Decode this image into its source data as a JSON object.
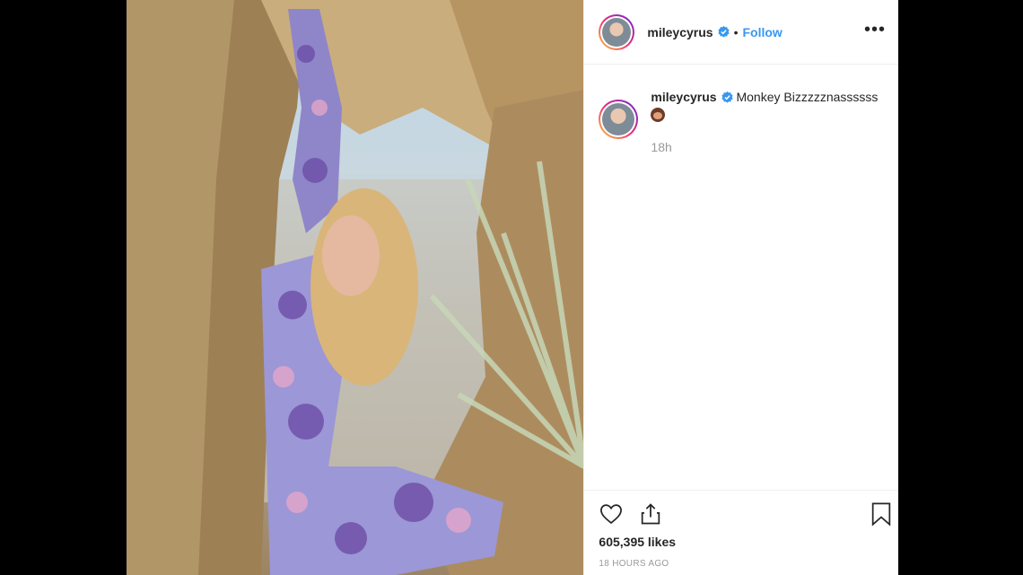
{
  "post": {
    "username": "mileycyrus",
    "follow_label": "Follow",
    "separator": "•",
    "more_label": "•••",
    "caption_user": "mileycyrus",
    "caption_text": "Monkey Bizzzzznassssss",
    "comment_time": "18h",
    "likes": "605,395 likes",
    "posted_ago": "18 HOURS AGO"
  },
  "icons": {
    "verified": "verified-badge-icon",
    "like": "heart-icon",
    "share": "share-icon",
    "save": "bookmark-icon",
    "emoji": "monkey-emoji-icon"
  },
  "colors": {
    "link": "#3897f0",
    "text": "#262626",
    "muted": "#999999"
  }
}
